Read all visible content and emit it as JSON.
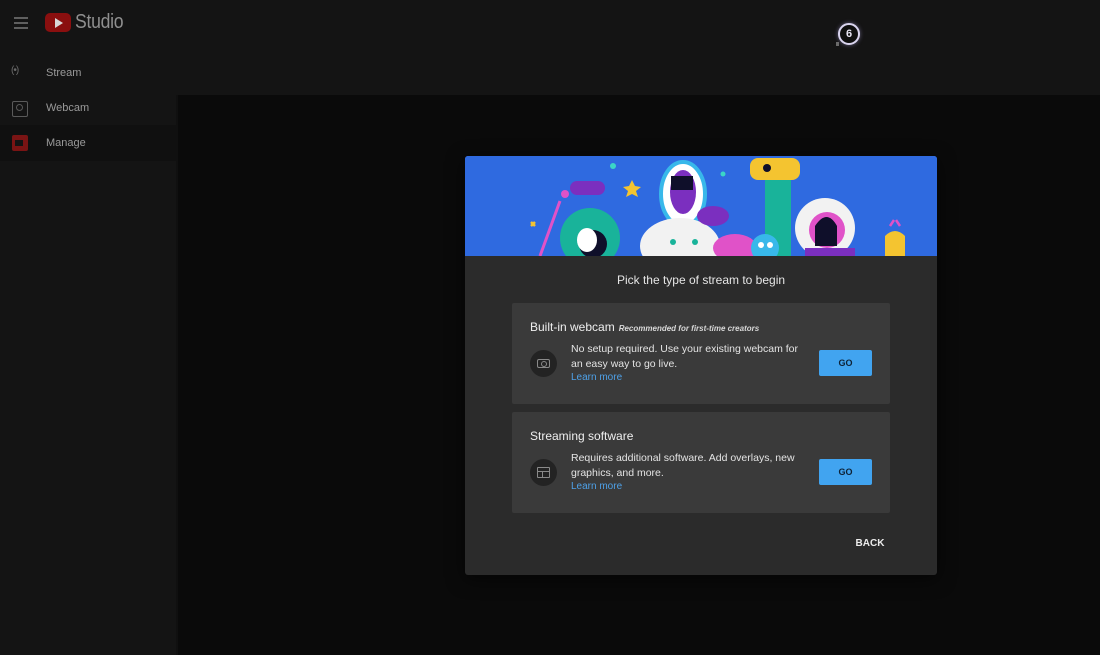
{
  "app": {
    "name": "Studio",
    "notification_count": "6"
  },
  "sidebar": {
    "items": [
      {
        "label": "Stream",
        "icon": "stream-icon"
      },
      {
        "label": "Webcam",
        "icon": "camera-icon"
      },
      {
        "label": "Manage",
        "icon": "calendar-icon",
        "active": true
      }
    ]
  },
  "modal": {
    "title": "Pick the type of stream to begin",
    "cards": [
      {
        "title": "Built-in webcam",
        "subtitle": "Recommended for first-time creators",
        "description": "No setup required. Use your existing webcam for an easy way to go live.",
        "link": "Learn more",
        "button": "GO",
        "icon": "camera-icon"
      },
      {
        "title": "Streaming software",
        "subtitle": "",
        "description": "Requires additional software. Add overlays, new graphics, and more.",
        "link": "Learn more",
        "button": "GO",
        "icon": "software-window-icon"
      }
    ],
    "back_label": "BACK"
  },
  "colors": {
    "accent_button": "#41a4f0",
    "banner": "#2f6ae0",
    "link": "#4ea1e8"
  }
}
